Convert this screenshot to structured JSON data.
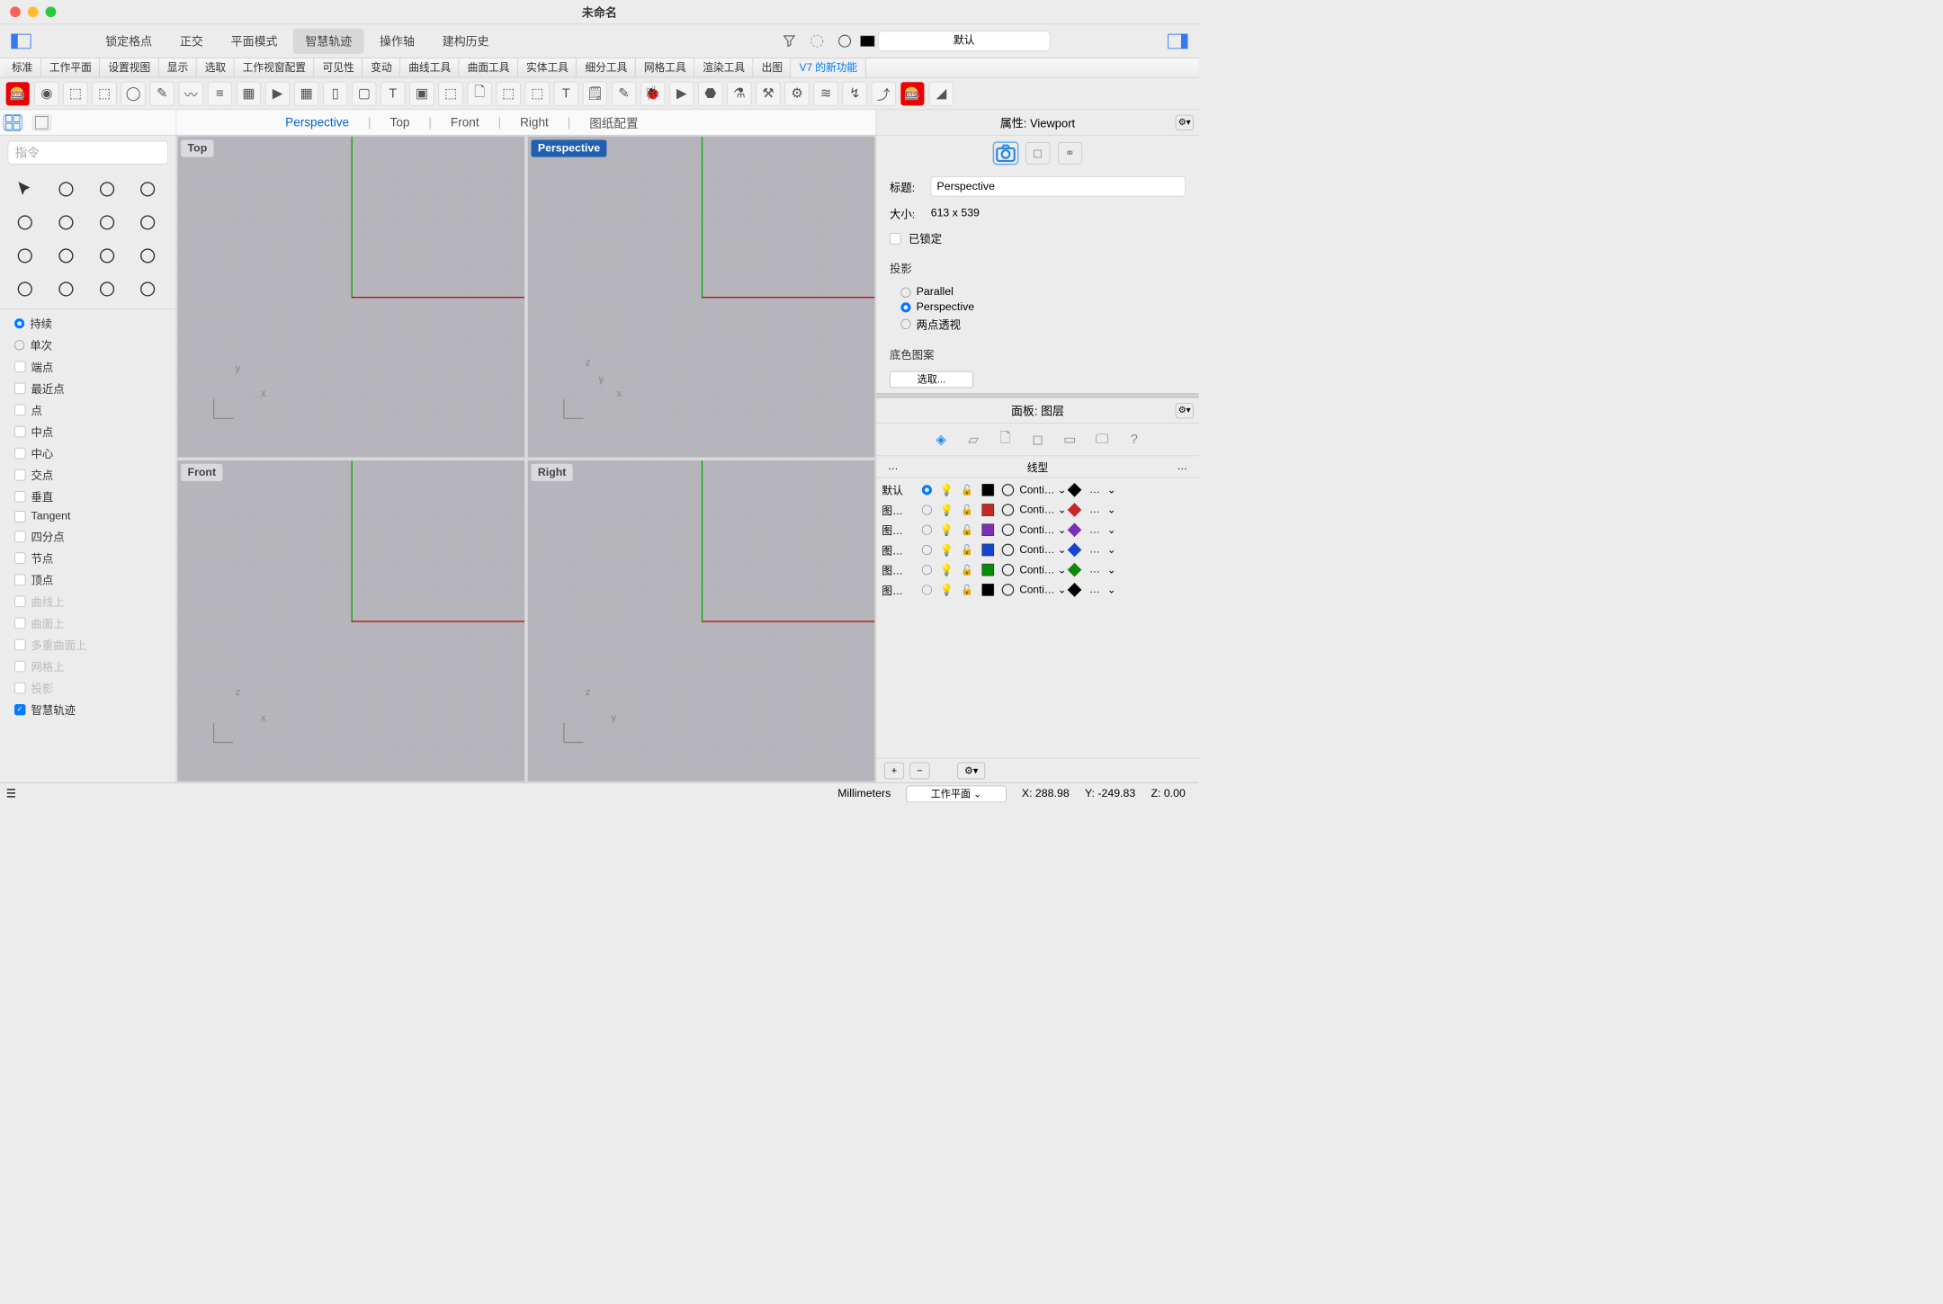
{
  "window_title": "未命名",
  "top_toolbar": [
    "锁定格点",
    "正交",
    "平面模式",
    "智慧轨迹",
    "操作轴",
    "建构历史"
  ],
  "top_toolbar_active": 3,
  "layer_selector": "默认",
  "tabs": [
    "标准",
    "工作平面",
    "设置视图",
    "显示",
    "选取",
    "工作视窗配置",
    "可见性",
    "变动",
    "曲线工具",
    "曲面工具",
    "实体工具",
    "细分工具",
    "网格工具",
    "渲染工具",
    "出图"
  ],
  "tabs_new": "V7 的新功能",
  "viewtabs": [
    "Perspective",
    "Top",
    "Front",
    "Right",
    "图纸配置"
  ],
  "viewtabs_active": 0,
  "command_placeholder": "指令",
  "osnap_radio": [
    {
      "label": "持续",
      "on": true
    },
    {
      "label": "单次",
      "on": false
    }
  ],
  "osnap": [
    {
      "label": "端点",
      "on": false
    },
    {
      "label": "最近点",
      "on": false
    },
    {
      "label": "点",
      "on": false
    },
    {
      "label": "中点",
      "on": false
    },
    {
      "label": "中心",
      "on": false
    },
    {
      "label": "交点",
      "on": false
    },
    {
      "label": "垂直",
      "on": false
    },
    {
      "label": "Tangent",
      "on": false
    },
    {
      "label": "四分点",
      "on": false
    },
    {
      "label": "节点",
      "on": false
    },
    {
      "label": "顶点",
      "on": false
    },
    {
      "label": "曲线上",
      "dim": true
    },
    {
      "label": "曲面上",
      "dim": true
    },
    {
      "label": "多重曲面上",
      "dim": true
    },
    {
      "label": "网格上",
      "dim": true
    },
    {
      "label": "投影",
      "dim": true
    },
    {
      "label": "智慧轨迹",
      "on": true
    }
  ],
  "viewports": [
    {
      "name": "Top",
      "axes": "xy"
    },
    {
      "name": "Perspective",
      "axes": "xyz",
      "active": true
    },
    {
      "name": "Front",
      "axes": "xz"
    },
    {
      "name": "Right",
      "axes": "yz"
    }
  ],
  "props": {
    "title": "属性: Viewport",
    "name_label": "标题:",
    "name_value": "Perspective",
    "size_label": "大小:",
    "size_value": "613 x 539",
    "locked_label": "已锁定",
    "proj_label": "投影",
    "proj": [
      {
        "label": "Parallel",
        "on": false
      },
      {
        "label": "Perspective",
        "on": true
      },
      {
        "label": "两点透视",
        "on": false
      }
    ],
    "wallpaper_label": "底色图案",
    "wallpaper_select": "选取..."
  },
  "layerpanel": {
    "title": "面板: 图层",
    "line_header": "线型",
    "layers": [
      {
        "name": "默认",
        "current": true,
        "color": "#000000",
        "line": "Conti…",
        "pcolor": "#000000"
      },
      {
        "name": "图…",
        "current": false,
        "color": "#c62828",
        "line": "Conti…",
        "pcolor": "#c62828"
      },
      {
        "name": "图…",
        "current": false,
        "color": "#7b2fb5",
        "line": "Conti…",
        "pcolor": "#7b2fb5"
      },
      {
        "name": "图…",
        "current": false,
        "color": "#1545d0",
        "line": "Conti…",
        "pcolor": "#1545d0"
      },
      {
        "name": "图…",
        "current": false,
        "color": "#0a8a0a",
        "line": "Conti…",
        "pcolor": "#0a8a0a"
      },
      {
        "name": "图…",
        "current": false,
        "color": "#000000",
        "line": "Conti…",
        "pcolor": "#000000"
      }
    ]
  },
  "status": {
    "units": "Millimeters",
    "cplane": "工作平面",
    "x": "X: 288.98",
    "y": "Y: -249.83",
    "z": "Z: 0.00"
  }
}
